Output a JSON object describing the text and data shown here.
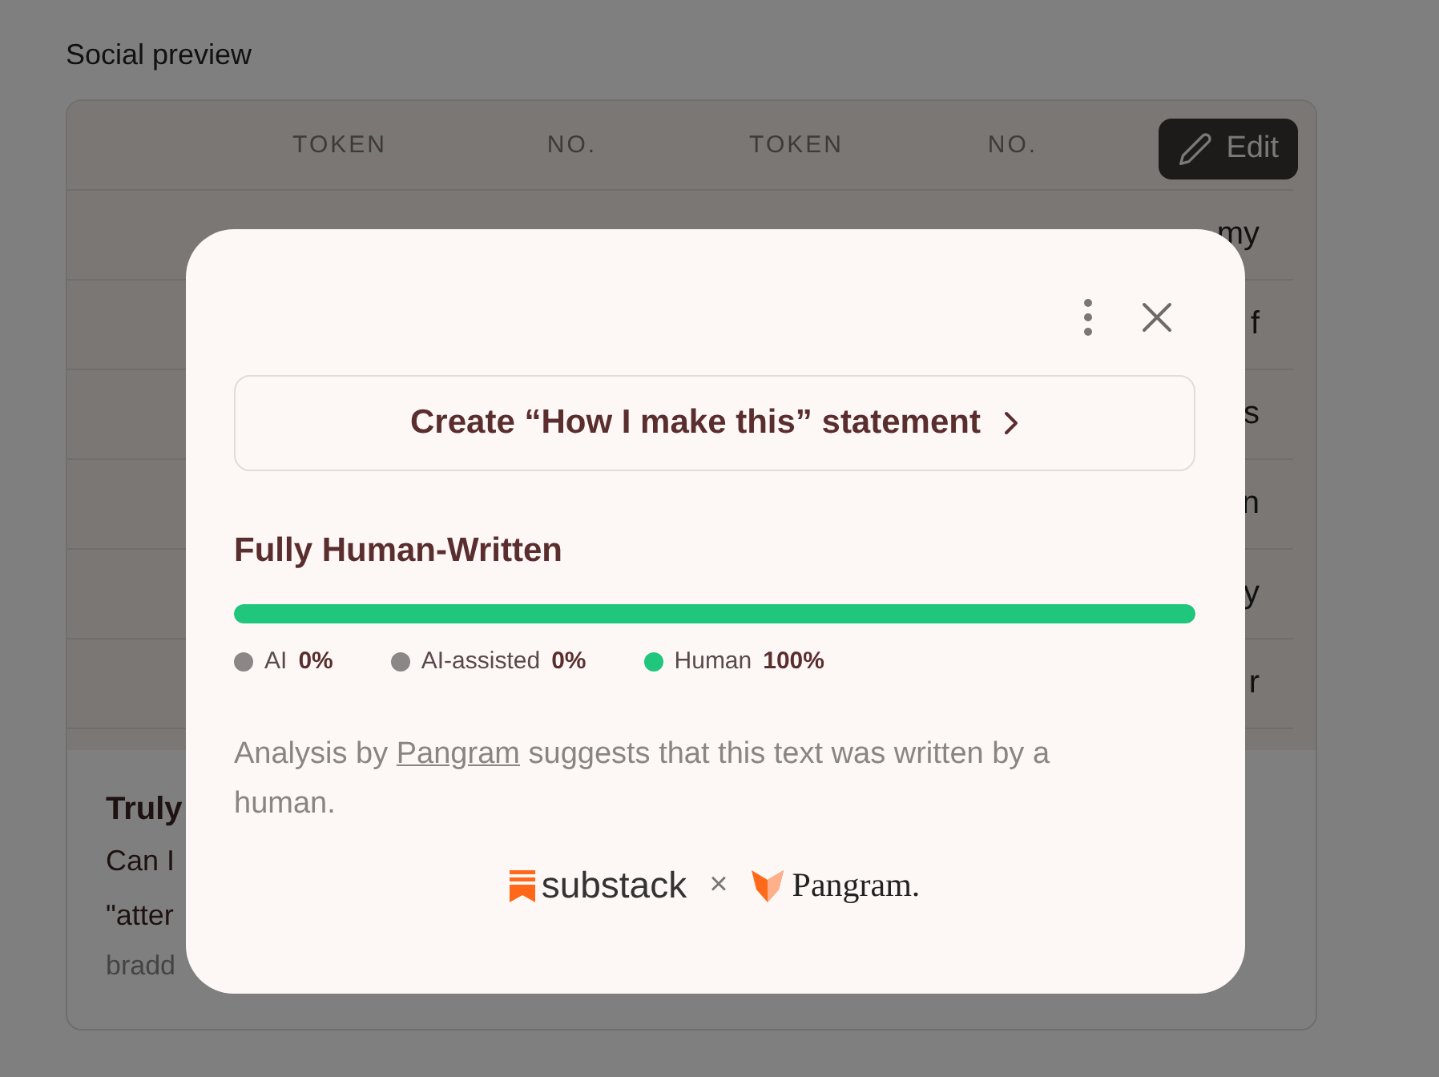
{
  "page": {
    "section_title": "Social preview",
    "table": {
      "columns": [
        "TOKEN",
        "NO.",
        "TOKEN",
        "NO."
      ],
      "rows": [
        {
          "column_5": "my"
        },
        {
          "column_5": "f"
        },
        {
          "column_5": "s"
        },
        {
          "column_5": "n"
        },
        {
          "column_5": "y"
        },
        {
          "column_5": "r"
        }
      ]
    },
    "edit_button": "Edit",
    "card": {
      "title": "Truly",
      "lines": [
        "Can I",
        "\"atter"
      ],
      "byline": "bradd"
    }
  },
  "dialog": {
    "statement_button": "Create “How I make this” statement",
    "verdict": "Fully Human-Written",
    "level": 1,
    "legend": [
      {
        "label": "AI",
        "value": "0%",
        "color": "#8a8786"
      },
      {
        "label": "AI-assisted",
        "value": "0%",
        "color": "#8a8786"
      },
      {
        "label": "Human",
        "value": "100%",
        "color": "#1fc67c"
      }
    ],
    "analysis": {
      "before": "Analysis by ",
      "link": "Pangram",
      "after": " suggests that this text was written by a human."
    },
    "logos": {
      "left": "substack",
      "separator": "×",
      "right": "Pangram."
    }
  }
}
